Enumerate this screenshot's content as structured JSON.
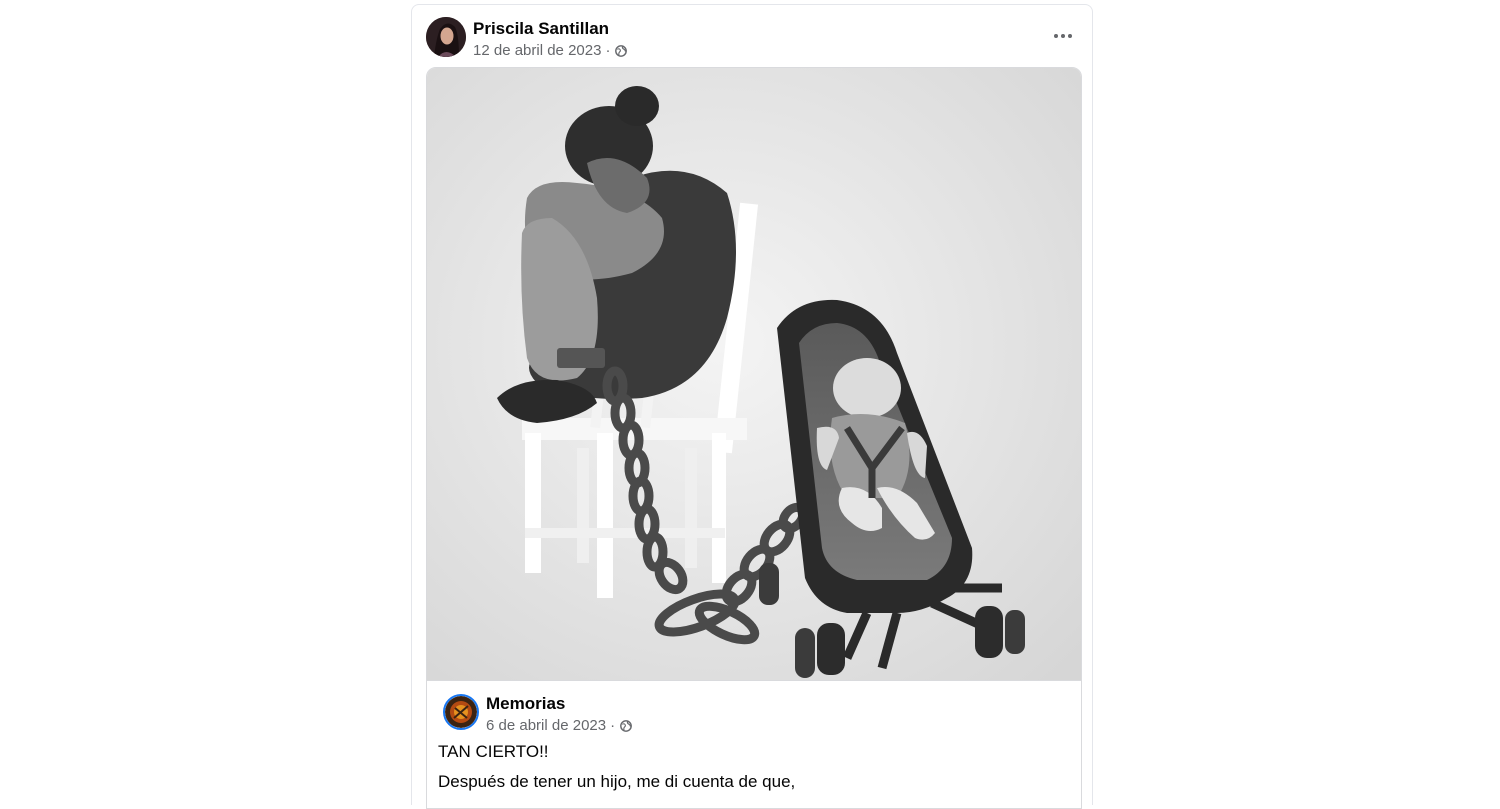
{
  "post": {
    "author": "Priscila Santillan",
    "date": "12 de abril de 2023",
    "separator": "·",
    "privacy_icon": "globe-icon",
    "menu_icon": "more-options-icon"
  },
  "shared_post": {
    "image_description_icon": "illustration-mother-chained-to-stroller",
    "page_name": "Memorias",
    "date": "6 de abril de 2023",
    "separator": "·",
    "privacy_icon": "globe-icon",
    "text_line1": "TAN CIERTO!!",
    "text_line2": "Después de tener un hijo, me di cuenta de que,"
  },
  "colors": {
    "text_primary": "#050505",
    "text_secondary": "#65676b",
    "accent": "#1877f2",
    "border": "#d9dadd"
  }
}
